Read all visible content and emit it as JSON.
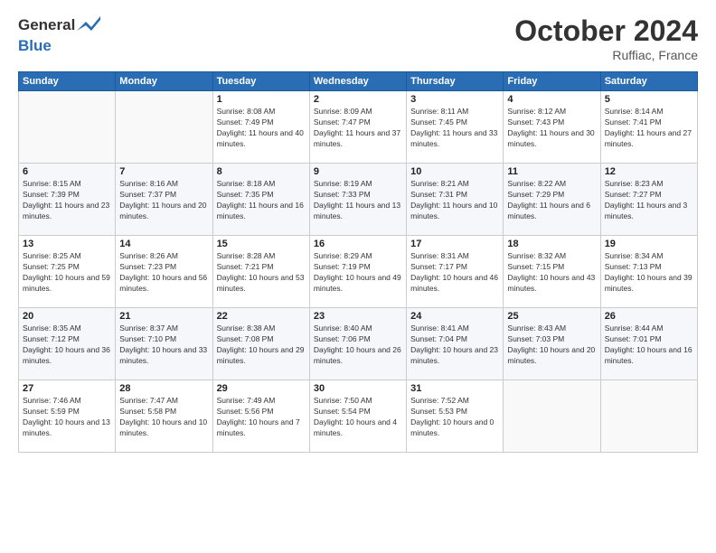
{
  "logo": {
    "line1": "General",
    "line2": "Blue"
  },
  "header": {
    "month": "October 2024",
    "location": "Ruffiac, France"
  },
  "columns": [
    "Sunday",
    "Monday",
    "Tuesday",
    "Wednesday",
    "Thursday",
    "Friday",
    "Saturday"
  ],
  "weeks": [
    [
      {
        "day": "",
        "sunrise": "",
        "sunset": "",
        "daylight": ""
      },
      {
        "day": "",
        "sunrise": "",
        "sunset": "",
        "daylight": ""
      },
      {
        "day": "1",
        "sunrise": "Sunrise: 8:08 AM",
        "sunset": "Sunset: 7:49 PM",
        "daylight": "Daylight: 11 hours and 40 minutes."
      },
      {
        "day": "2",
        "sunrise": "Sunrise: 8:09 AM",
        "sunset": "Sunset: 7:47 PM",
        "daylight": "Daylight: 11 hours and 37 minutes."
      },
      {
        "day": "3",
        "sunrise": "Sunrise: 8:11 AM",
        "sunset": "Sunset: 7:45 PM",
        "daylight": "Daylight: 11 hours and 33 minutes."
      },
      {
        "day": "4",
        "sunrise": "Sunrise: 8:12 AM",
        "sunset": "Sunset: 7:43 PM",
        "daylight": "Daylight: 11 hours and 30 minutes."
      },
      {
        "day": "5",
        "sunrise": "Sunrise: 8:14 AM",
        "sunset": "Sunset: 7:41 PM",
        "daylight": "Daylight: 11 hours and 27 minutes."
      }
    ],
    [
      {
        "day": "6",
        "sunrise": "Sunrise: 8:15 AM",
        "sunset": "Sunset: 7:39 PM",
        "daylight": "Daylight: 11 hours and 23 minutes."
      },
      {
        "day": "7",
        "sunrise": "Sunrise: 8:16 AM",
        "sunset": "Sunset: 7:37 PM",
        "daylight": "Daylight: 11 hours and 20 minutes."
      },
      {
        "day": "8",
        "sunrise": "Sunrise: 8:18 AM",
        "sunset": "Sunset: 7:35 PM",
        "daylight": "Daylight: 11 hours and 16 minutes."
      },
      {
        "day": "9",
        "sunrise": "Sunrise: 8:19 AM",
        "sunset": "Sunset: 7:33 PM",
        "daylight": "Daylight: 11 hours and 13 minutes."
      },
      {
        "day": "10",
        "sunrise": "Sunrise: 8:21 AM",
        "sunset": "Sunset: 7:31 PM",
        "daylight": "Daylight: 11 hours and 10 minutes."
      },
      {
        "day": "11",
        "sunrise": "Sunrise: 8:22 AM",
        "sunset": "Sunset: 7:29 PM",
        "daylight": "Daylight: 11 hours and 6 minutes."
      },
      {
        "day": "12",
        "sunrise": "Sunrise: 8:23 AM",
        "sunset": "Sunset: 7:27 PM",
        "daylight": "Daylight: 11 hours and 3 minutes."
      }
    ],
    [
      {
        "day": "13",
        "sunrise": "Sunrise: 8:25 AM",
        "sunset": "Sunset: 7:25 PM",
        "daylight": "Daylight: 10 hours and 59 minutes."
      },
      {
        "day": "14",
        "sunrise": "Sunrise: 8:26 AM",
        "sunset": "Sunset: 7:23 PM",
        "daylight": "Daylight: 10 hours and 56 minutes."
      },
      {
        "day": "15",
        "sunrise": "Sunrise: 8:28 AM",
        "sunset": "Sunset: 7:21 PM",
        "daylight": "Daylight: 10 hours and 53 minutes."
      },
      {
        "day": "16",
        "sunrise": "Sunrise: 8:29 AM",
        "sunset": "Sunset: 7:19 PM",
        "daylight": "Daylight: 10 hours and 49 minutes."
      },
      {
        "day": "17",
        "sunrise": "Sunrise: 8:31 AM",
        "sunset": "Sunset: 7:17 PM",
        "daylight": "Daylight: 10 hours and 46 minutes."
      },
      {
        "day": "18",
        "sunrise": "Sunrise: 8:32 AM",
        "sunset": "Sunset: 7:15 PM",
        "daylight": "Daylight: 10 hours and 43 minutes."
      },
      {
        "day": "19",
        "sunrise": "Sunrise: 8:34 AM",
        "sunset": "Sunset: 7:13 PM",
        "daylight": "Daylight: 10 hours and 39 minutes."
      }
    ],
    [
      {
        "day": "20",
        "sunrise": "Sunrise: 8:35 AM",
        "sunset": "Sunset: 7:12 PM",
        "daylight": "Daylight: 10 hours and 36 minutes."
      },
      {
        "day": "21",
        "sunrise": "Sunrise: 8:37 AM",
        "sunset": "Sunset: 7:10 PM",
        "daylight": "Daylight: 10 hours and 33 minutes."
      },
      {
        "day": "22",
        "sunrise": "Sunrise: 8:38 AM",
        "sunset": "Sunset: 7:08 PM",
        "daylight": "Daylight: 10 hours and 29 minutes."
      },
      {
        "day": "23",
        "sunrise": "Sunrise: 8:40 AM",
        "sunset": "Sunset: 7:06 PM",
        "daylight": "Daylight: 10 hours and 26 minutes."
      },
      {
        "day": "24",
        "sunrise": "Sunrise: 8:41 AM",
        "sunset": "Sunset: 7:04 PM",
        "daylight": "Daylight: 10 hours and 23 minutes."
      },
      {
        "day": "25",
        "sunrise": "Sunrise: 8:43 AM",
        "sunset": "Sunset: 7:03 PM",
        "daylight": "Daylight: 10 hours and 20 minutes."
      },
      {
        "day": "26",
        "sunrise": "Sunrise: 8:44 AM",
        "sunset": "Sunset: 7:01 PM",
        "daylight": "Daylight: 10 hours and 16 minutes."
      }
    ],
    [
      {
        "day": "27",
        "sunrise": "Sunrise: 7:46 AM",
        "sunset": "Sunset: 5:59 PM",
        "daylight": "Daylight: 10 hours and 13 minutes."
      },
      {
        "day": "28",
        "sunrise": "Sunrise: 7:47 AM",
        "sunset": "Sunset: 5:58 PM",
        "daylight": "Daylight: 10 hours and 10 minutes."
      },
      {
        "day": "29",
        "sunrise": "Sunrise: 7:49 AM",
        "sunset": "Sunset: 5:56 PM",
        "daylight": "Daylight: 10 hours and 7 minutes."
      },
      {
        "day": "30",
        "sunrise": "Sunrise: 7:50 AM",
        "sunset": "Sunset: 5:54 PM",
        "daylight": "Daylight: 10 hours and 4 minutes."
      },
      {
        "day": "31",
        "sunrise": "Sunrise: 7:52 AM",
        "sunset": "Sunset: 5:53 PM",
        "daylight": "Daylight: 10 hours and 0 minutes."
      },
      {
        "day": "",
        "sunrise": "",
        "sunset": "",
        "daylight": ""
      },
      {
        "day": "",
        "sunrise": "",
        "sunset": "",
        "daylight": ""
      }
    ]
  ]
}
